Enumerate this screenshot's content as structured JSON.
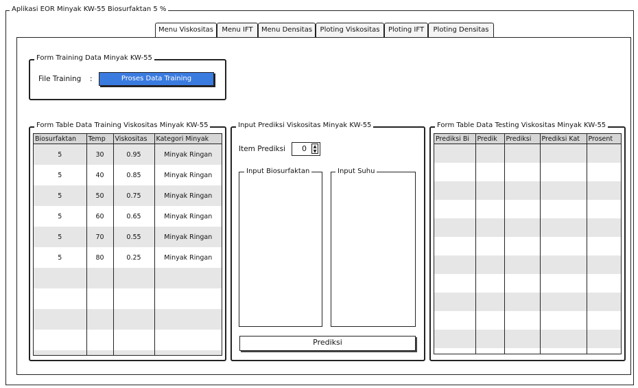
{
  "window": {
    "title": "Aplikasi EOR Minyak KW-55 Biosurfaktan 5 %"
  },
  "tabs": [
    {
      "label": "Menu Viskositas"
    },
    {
      "label": "Menu IFT"
    },
    {
      "label": "Menu Densitas"
    },
    {
      "label": "Ploting Viskositas"
    },
    {
      "label": "Ploting IFT"
    },
    {
      "label": "Ploting Densitas"
    }
  ],
  "training_form": {
    "legend": "Form Training Data Minyak KW-55",
    "file_label": "File Training",
    "separator": ":",
    "button_label": "Proses Data Training",
    "accent_color": "#3a7be0"
  },
  "training_table": {
    "legend": "Form Table Data Training Viskositas Minyak KW-55",
    "headers": [
      "Biosurfaktan",
      "Temp",
      "Viskositas",
      "Kategori Minyak"
    ],
    "rows": [
      [
        "5",
        "30",
        "0.95",
        "Minyak Ringan"
      ],
      [
        "5",
        "40",
        "0.85",
        "Minyak Ringan"
      ],
      [
        "5",
        "50",
        "0.75",
        "Minyak Ringan"
      ],
      [
        "5",
        "60",
        "0.65",
        "Minyak Ringan"
      ],
      [
        "5",
        "70",
        "0.55",
        "Minyak Ringan"
      ],
      [
        "5",
        "80",
        "0.25",
        "Minyak Ringan"
      ],
      [
        "",
        "",
        "",
        ""
      ],
      [
        "",
        "",
        "",
        ""
      ],
      [
        "",
        "",
        "",
        ""
      ],
      [
        "",
        "",
        "",
        ""
      ],
      [
        "",
        "",
        "",
        ""
      ]
    ]
  },
  "prediction": {
    "legend": "Input Prediksi Viskositas Minyak KW-55",
    "item_label": "Item Prediksi",
    "item_value": "0",
    "biosurfaktan_legend": "Input Biosurfaktan",
    "suhu_legend": "Input Suhu",
    "button_label": "Prediksi"
  },
  "testing_table": {
    "legend": "Form Table Data Testing Viskositas Minyak KW-55",
    "headers": [
      "Prediksi Bi",
      "Predik",
      "Prediksi",
      "Prediksi Kat",
      "Prosent"
    ],
    "rows": [
      [
        "",
        "",
        "",
        "",
        ""
      ],
      [
        "",
        "",
        "",
        "",
        ""
      ],
      [
        "",
        "",
        "",
        "",
        ""
      ],
      [
        "",
        "",
        "",
        "",
        ""
      ],
      [
        "",
        "",
        "",
        "",
        ""
      ],
      [
        "",
        "",
        "",
        "",
        ""
      ],
      [
        "",
        "",
        "",
        "",
        ""
      ],
      [
        "",
        "",
        "",
        "",
        ""
      ],
      [
        "",
        "",
        "",
        "",
        ""
      ],
      [
        "",
        "",
        "",
        "",
        ""
      ],
      [
        "",
        "",
        "",
        "",
        ""
      ],
      [
        "",
        "",
        "",
        "",
        ""
      ]
    ]
  }
}
